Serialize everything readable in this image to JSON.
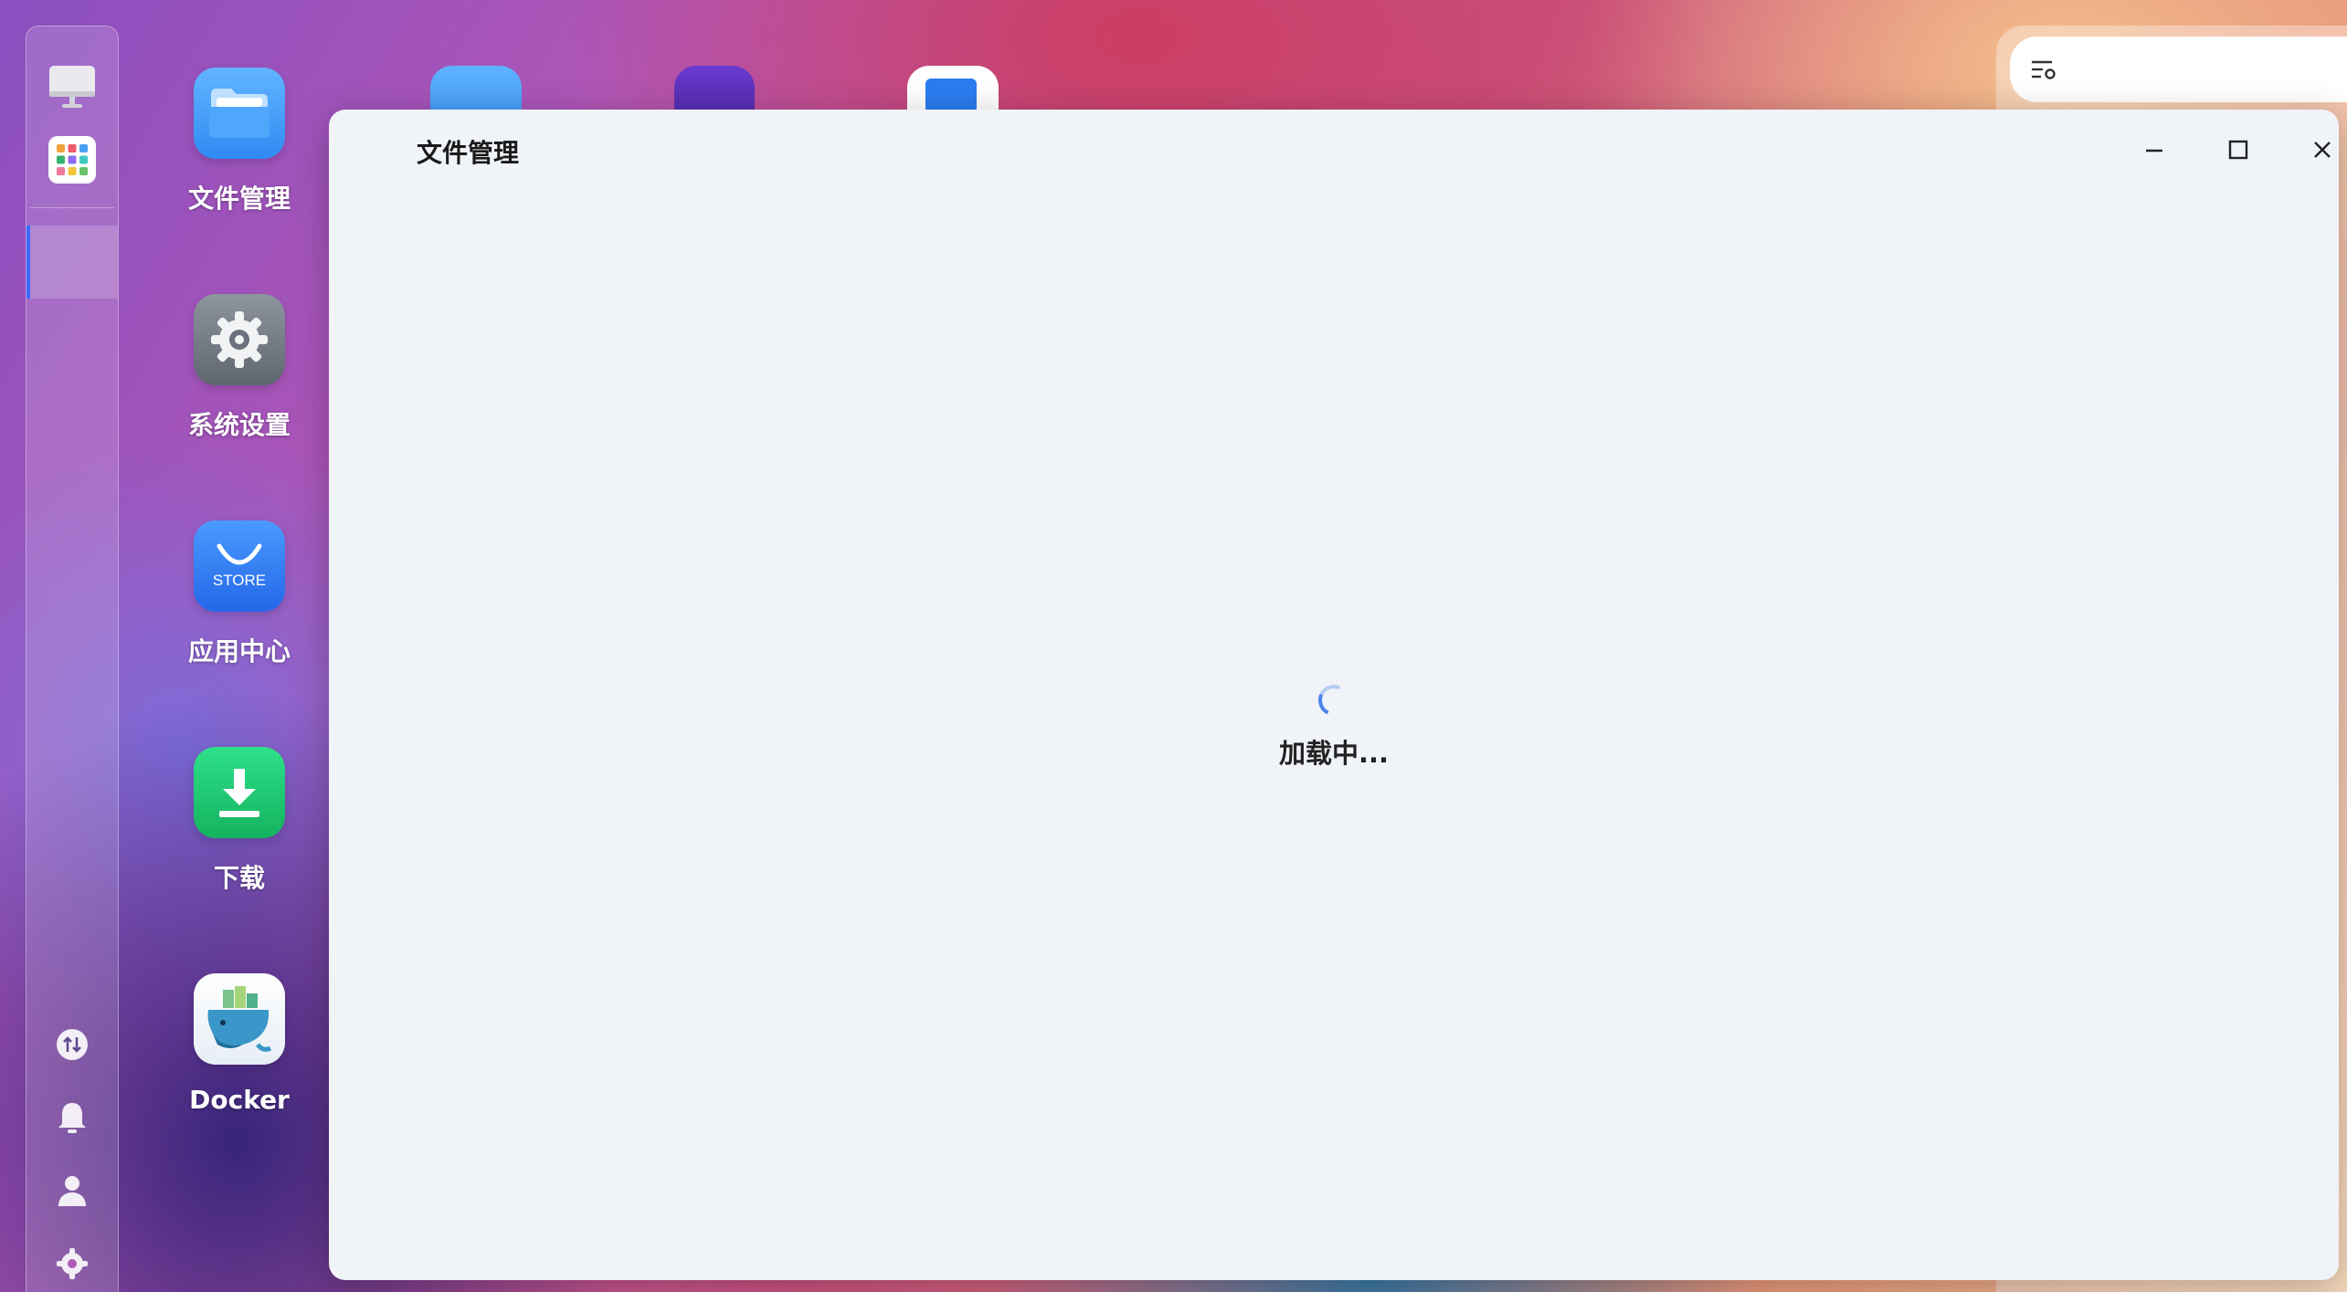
{
  "desktop": {
    "apps": [
      {
        "label": "文件管理",
        "icon": "folder-icon"
      },
      {
        "label": "系统设置",
        "icon": "gear-icon"
      },
      {
        "label": "应用中心",
        "icon": "store-bag-icon",
        "icon_text": "STORE"
      },
      {
        "label": "下载",
        "icon": "download-icon"
      },
      {
        "label": "Docker",
        "icon": "docker-whale-icon"
      }
    ]
  },
  "dock": {
    "top_items": [
      {
        "icon": "monitor-icon"
      },
      {
        "icon": "app-grid-icon"
      }
    ],
    "bottom_items": [
      {
        "icon": "transfer-arrows-icon"
      },
      {
        "icon": "bell-icon"
      },
      {
        "icon": "user-icon"
      },
      {
        "icon": "settings-gear-icon"
      }
    ]
  },
  "window": {
    "title": "文件管理",
    "controls": [
      "minimize-icon",
      "maximize-icon",
      "close-icon"
    ],
    "loading_text": "加载中..."
  },
  "widget": {
    "icon": "list-settings-icon"
  },
  "colors": {
    "accent": "#3b6bff",
    "spinner": "#4a84ef",
    "window_bg": "#f0f3f8",
    "download_green": "#1fc46b",
    "store_blue": "#2f7bf5"
  }
}
